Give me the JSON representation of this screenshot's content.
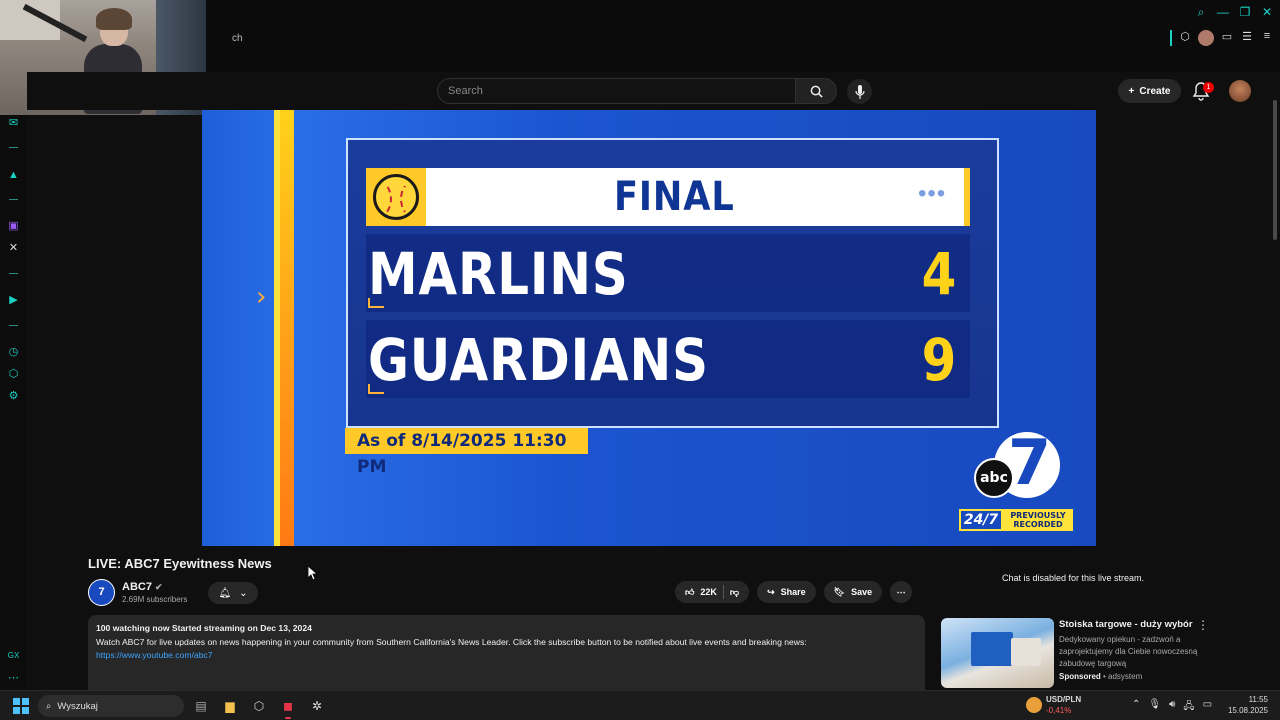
{
  "browser": {
    "tab_partial": "ch",
    "window_controls": [
      "search-icon",
      "minimize-icon",
      "restore-icon",
      "close-icon"
    ],
    "sidebar_icons": [
      "messenger-icon",
      "aria-icon",
      "twitch-icon",
      "x-icon",
      "player-icon",
      "history-icon",
      "extensions-icon",
      "settings-icon",
      "gx-icon",
      "more-icon"
    ]
  },
  "header": {
    "search_placeholder": "Search",
    "create_label": "Create",
    "notification_count": "1"
  },
  "video": {
    "final_label": "FINAL",
    "dots": "•••",
    "teams": [
      {
        "name": "MARLINS",
        "score": "4"
      },
      {
        "name": "GUARDIANS",
        "score": "9"
      }
    ],
    "as_of": "As of 8/14/2025 11:30 PM",
    "logo_text": "abc",
    "badge_247": "24/7",
    "badge_text": "PREVIOUSLY RECORDED",
    "colors": {
      "blue": "#1849bf",
      "yellow": "#ffc928",
      "navy": "#0f3595"
    }
  },
  "meta": {
    "title": "LIVE: ABC7 Eyewitness News",
    "channel_name": "ABC7",
    "channel_avatar": "7",
    "subscribers": "2.69M subscribers",
    "likes": "22K",
    "share_label": "Share",
    "save_label": "Save",
    "description_meta": "100 watching now  Started streaming on Dec 13, 2024",
    "description_text": "Watch ABC7 for live updates on news happening in your community from Southern California's News Leader. Click the subscribe button to be notified about live events and breaking news:",
    "description_link": "https://www.youtube.com/abc7"
  },
  "chat": {
    "disabled_text": "Chat is disabled for this live stream."
  },
  "ad": {
    "title": "Stoiska targowe - duży wybór",
    "text": "Dedykowany opiekun - zadzwoń a zaprojektujemy dla Ciebie nowoczesną zabudowę targową",
    "sponsored": "Sponsored",
    "advertiser": "adsystem"
  },
  "taskbar": {
    "search_placeholder": "Wyszukaj",
    "fx_pair": "USD/PLN",
    "fx_change": "-0,41%",
    "time": "11:55",
    "date": "15.08.2025"
  }
}
